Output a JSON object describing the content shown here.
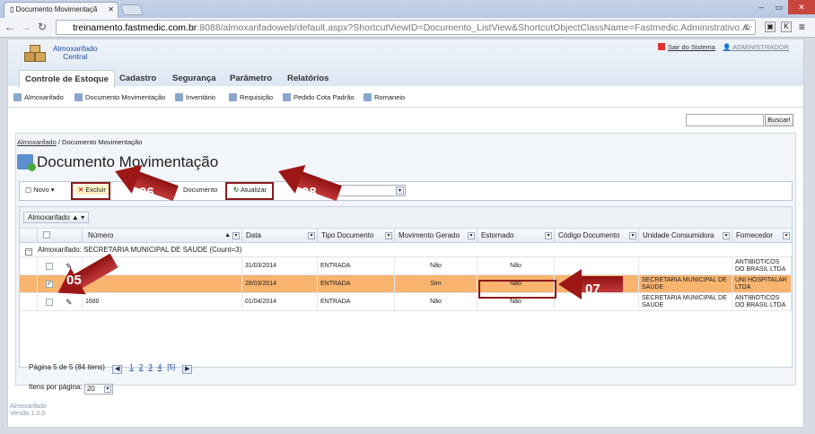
{
  "browser": {
    "tab_title": "Documento Movimentaçã",
    "url_host": "treinamento.fastmedic.com.br",
    "url_rest": ":8088/almoxarifadoweb/default.aspx?ShortcutViewID=Documento_ListView&ShortcutObjectClassName=Fastmedic.Administrativo.A"
  },
  "header": {
    "logo_line1": "Almoxarifado",
    "logo_line2": "Central",
    "logout": "Sair do Sistema",
    "user": "ADMINISTRADOR"
  },
  "menu": [
    "Controle de Estoque",
    "Cadastro",
    "Segurança",
    "Parâmetro",
    "Relatórios"
  ],
  "submenu": [
    "Almoxarifado",
    "Documento Movimentação",
    "Inventário",
    "Requisição",
    "Pedido Cota Padrão",
    "Romaneio"
  ],
  "search_button": "Buscar!",
  "breadcrumb": {
    "link": "Almoxarifado",
    "current": "/ Documento Movimentação"
  },
  "page_title": "Documento Movimentação",
  "toolbar": {
    "new": "Novo",
    "delete": "Excluir",
    "doc": "Documento",
    "refresh": "Atualizar"
  },
  "group_chip": "Almoxarifado",
  "columns": [
    "Número",
    "Data",
    "Tipo Documento",
    "Movimento Gerado",
    "Estornado",
    "Código Documento",
    "Unidade Consumidora",
    "Fornecedor"
  ],
  "group_row": "Almoxarifado: SECRETARIA MUNICIPAL DE SAUDE (Count=3)",
  "rows": [
    {
      "numero": "",
      "data": "31/03/2014",
      "tipo": "ENTRADA",
      "mov": "Não",
      "est": "Não",
      "cod": "",
      "unidade": "",
      "forn": "ANTIBIOTICOS DO BRASIL LTDA"
    },
    {
      "numero": "",
      "data": "28/03/2014",
      "tipo": "ENTRADA",
      "mov": "Sim",
      "est": "Não",
      "cod": "",
      "unidade": "SECRETARIA MUNICIPAL DE SAUDE",
      "forn": "UNI HOSPITALAR LTDA"
    },
    {
      "numero": "1680",
      "data": "01/04/2014",
      "tipo": "ENTRADA",
      "mov": "Não",
      "est": "Não",
      "cod": "",
      "unidade": "SECRETARIA MUNICIPAL DE SAUDE",
      "forn": "ANTIBIOTICOS DO BRASIL LTDA"
    }
  ],
  "pager": {
    "info": "Página 5 de 5 (84 itens)",
    "pages": [
      "1",
      "2",
      "3",
      "4"
    ],
    "current": "[5]"
  },
  "per_page": {
    "label": "Itens por página:",
    "value": "20"
  },
  "footer": {
    "line1": "Almoxarifado",
    "line2": "Versão 1.0.0"
  },
  "callouts": [
    "05",
    "06",
    "07",
    "08"
  ]
}
